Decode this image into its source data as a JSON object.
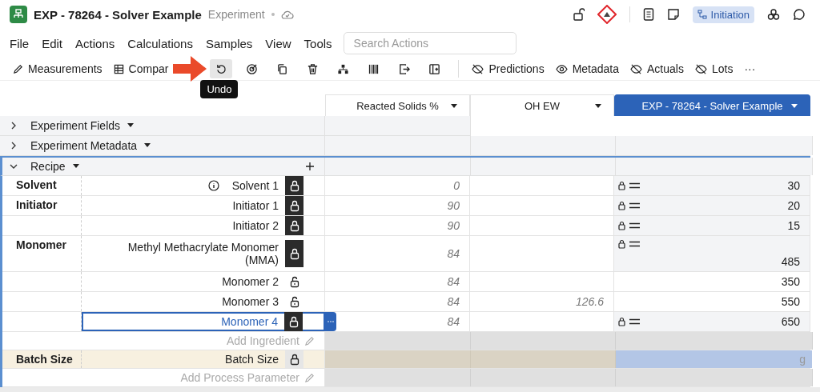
{
  "header": {
    "title": "EXP - 78264 - Solver Example",
    "subtitle": "Experiment",
    "status": "Initiation"
  },
  "menu": {
    "items": [
      "File",
      "Edit",
      "Actions",
      "Calculations",
      "Samples",
      "View",
      "Tools"
    ],
    "search": {
      "placeholder": "Search Actions"
    }
  },
  "toolbar": [
    {
      "kind": "text",
      "label": "Measurements"
    },
    {
      "kind": "text",
      "label": "Compar"
    },
    {
      "kind": "icon",
      "active": true
    },
    {
      "kind": "icon",
      "active": false
    },
    {
      "kind": "icon",
      "active": false
    },
    {
      "kind": "icon",
      "active": false
    },
    {
      "kind": "icon",
      "active": false
    },
    {
      "kind": "icon",
      "active": false
    },
    {
      "kind": "icon",
      "active": false
    },
    {
      "kind": "icon",
      "active": false
    },
    {
      "kind": "divider"
    },
    {
      "kind": "text",
      "label": "Predictions"
    },
    {
      "kind": "text",
      "label": "Metadata"
    },
    {
      "kind": "text",
      "label": "Actuals"
    },
    {
      "kind": "text",
      "label": "Lots"
    },
    {
      "kind": "text",
      "label": "···"
    }
  ],
  "tooltip": "Undo",
  "columns": [
    {
      "label": "Reacted Solids %",
      "selected": false
    },
    {
      "label": "OH EW",
      "selected": false
    },
    {
      "label": "EXP - 78264 - Solver Example",
      "selected": true
    }
  ],
  "sections": [
    {
      "label": "Experiment Fields",
      "expanded": false
    },
    {
      "label": "Experiment Metadata",
      "expanded": false
    },
    {
      "label": "Recipe",
      "expanded": true
    }
  ],
  "rows": [
    {
      "kind": "ingredient",
      "category": "Solvent",
      "name": "Solvent 1",
      "info": true,
      "locked": true,
      "selected": false,
      "reacted_solids": "0",
      "amount": "30",
      "fixed": true
    },
    {
      "kind": "ingredient",
      "category": "Initiator",
      "name": "Initiator 1",
      "info": false,
      "locked": true,
      "selected": false,
      "reacted_solids": "90",
      "amount": "20",
      "fixed": true
    },
    {
      "kind": "ingredient",
      "name": "Initiator 2",
      "info": false,
      "locked": true,
      "selected": false,
      "reacted_solids": "90",
      "amount": "15",
      "fixed": true
    },
    {
      "kind": "ingredient",
      "category": "Monomer",
      "name": "Methyl Methacrylate Monomer (MMA)",
      "info": false,
      "locked": true,
      "selected": false,
      "reacted_solids": "84",
      "amount": "485",
      "fixed": true
    },
    {
      "kind": "ingredient",
      "name": "Monomer 2",
      "info": false,
      "locked": false,
      "selected": false,
      "reacted_solids": "84",
      "amount": "350",
      "fixed": false
    },
    {
      "kind": "ingredient",
      "name": "Monomer 3",
      "info": false,
      "locked": false,
      "selected": false,
      "reacted_solids": "84",
      "oh_ew": "126.6",
      "amount": "550",
      "fixed": false
    },
    {
      "kind": "ingredient",
      "name": "Monomer 4",
      "info": false,
      "locked": true,
      "selected": true,
      "reacted_solids": "84",
      "amount": "650",
      "fixed": true
    },
    {
      "kind": "add",
      "label": "Add Ingredient"
    },
    {
      "kind": "parameter",
      "category": "Batch Size",
      "name": "Batch Size",
      "unit": "g"
    },
    {
      "kind": "add",
      "label": "Add Process Parameter"
    }
  ]
}
